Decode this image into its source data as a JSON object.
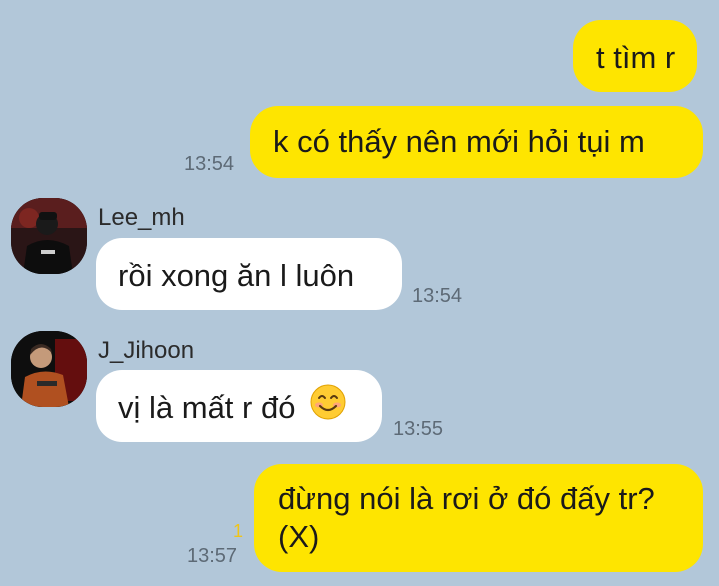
{
  "messages": [
    {
      "id": "m1",
      "direction": "outgoing",
      "text": "t tìm r",
      "time": ""
    },
    {
      "id": "m2",
      "direction": "outgoing",
      "text": "k có thấy nên mới hỏi tụi m",
      "time": "13:54"
    },
    {
      "id": "m3",
      "direction": "incoming",
      "sender": "Lee_mh",
      "text": "rồi xong ăn l luôn",
      "time": "13:54"
    },
    {
      "id": "m4",
      "direction": "incoming",
      "sender": "J_Jihoon",
      "text": "vị là mất r đó",
      "emoji": "smiling-face-emoji",
      "time": "13:55"
    },
    {
      "id": "m5",
      "direction": "outgoing",
      "text_line1": "đừng nói là rơi ở đó đấy tr?",
      "text_line2": "(X)",
      "time": "13:57",
      "unread_count": "1"
    }
  ],
  "colors": {
    "background": "#b2c7d9",
    "outgoing_bubble": "#fee500",
    "incoming_bubble": "#ffffff",
    "timestamp": "#5d6a76",
    "unread": "#f0c419"
  },
  "icons": {
    "avatar_lee": "avatar-lee-mh",
    "avatar_jihoon": "avatar-j-jihoon"
  }
}
